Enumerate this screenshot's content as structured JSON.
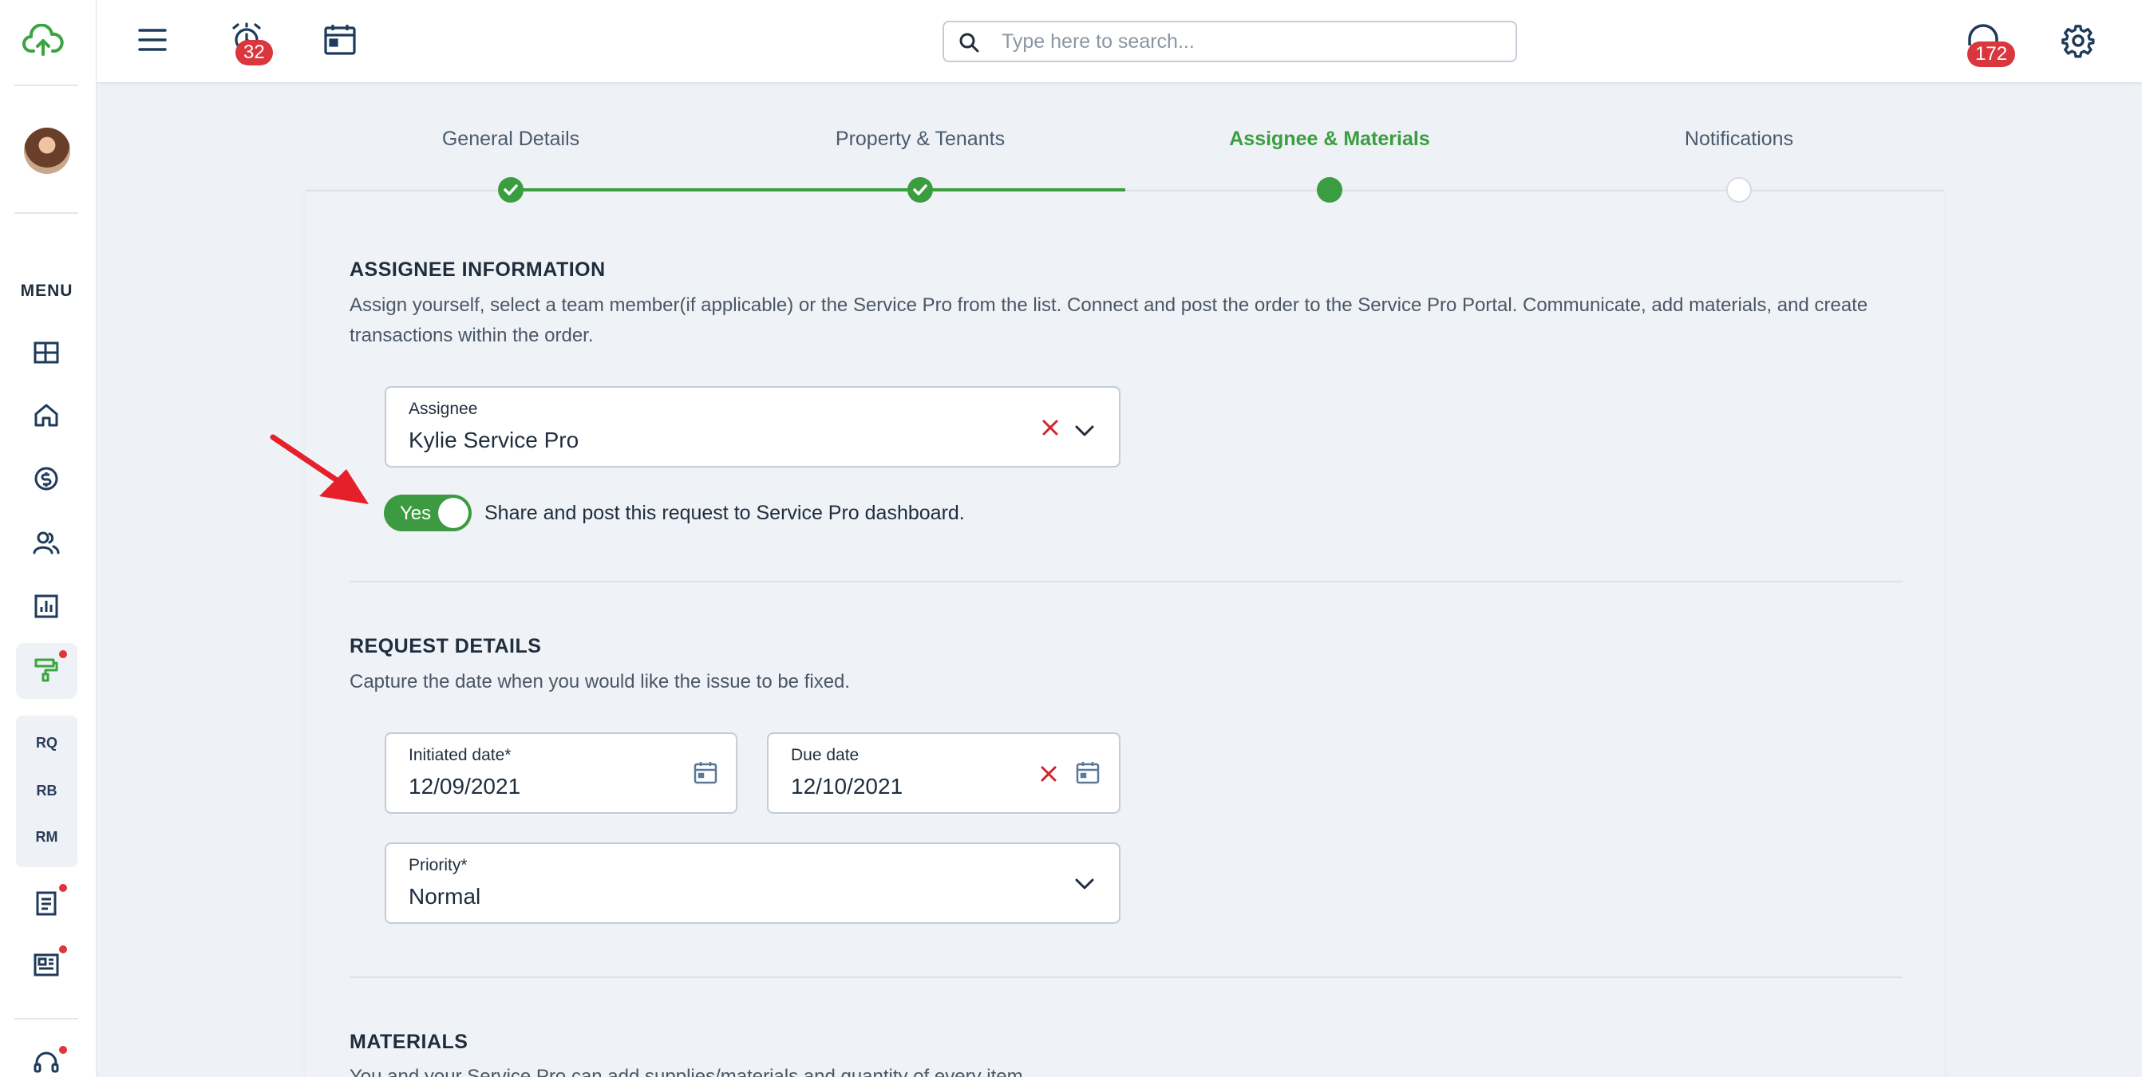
{
  "header": {
    "alerts_badge": "32",
    "support_badge": "172",
    "search": {
      "placeholder": "Type here to search..."
    }
  },
  "sidebar": {
    "menu_label": "MENU",
    "sub_items": [
      "RQ",
      "RB",
      "RM"
    ]
  },
  "stepper": {
    "steps": [
      {
        "label": "General Details",
        "state": "complete"
      },
      {
        "label": "Property & Tenants",
        "state": "complete"
      },
      {
        "label": "Assignee & Materials",
        "state": "active"
      },
      {
        "label": "Notifications",
        "state": "pending"
      }
    ]
  },
  "assignee_section": {
    "title": "ASSIGNEE INFORMATION",
    "description": "Assign yourself, select a team member(if applicable) or the Service Pro from the list. Connect and post the order to the Service Pro Portal. Communicate, add materials, and create transactions within the order.",
    "assignee_label": "Assignee",
    "assignee_value": "Kylie Service Pro",
    "toggle_label": "Yes",
    "toggle_on": true,
    "share_text": "Share and post this request to Service Pro dashboard."
  },
  "request_section": {
    "title": "REQUEST DETAILS",
    "description": "Capture the date when you would like the issue to be fixed.",
    "initiated_label": "Initiated date*",
    "initiated_value": "12/09/2021",
    "due_label": "Due date",
    "due_value": "12/10/2021",
    "priority_label": "Priority*",
    "priority_value": "Normal"
  },
  "materials_section": {
    "title": "MATERIALS",
    "description_partial": "You and your Service Pro can add supplies/materials and quantity of every item."
  },
  "colors": {
    "accent_green": "#3a9d3f",
    "badge_red": "#d9363e",
    "clear_red": "#d0242c",
    "text_dark": "#1f2d3d"
  }
}
